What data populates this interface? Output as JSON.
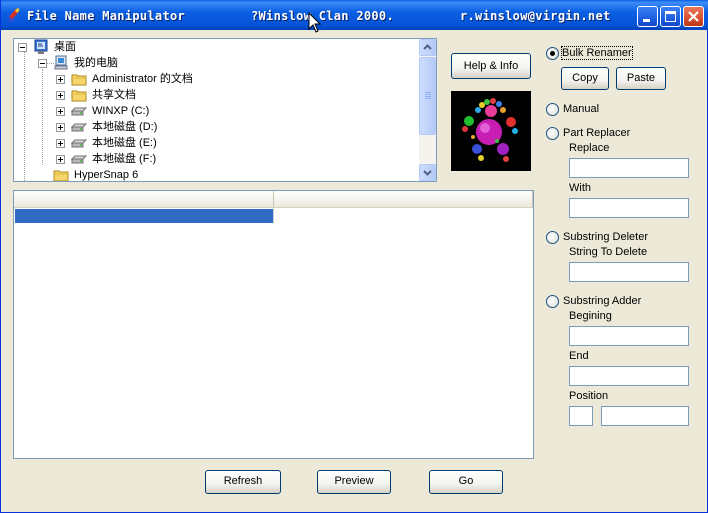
{
  "window": {
    "title_app": "File Name Manipulator",
    "title_author": "?Winslow Clan 2000.",
    "title_email": "r.winslow@virgin.net"
  },
  "tree": {
    "items": [
      {
        "label": "桌面",
        "icon": "desktop-icon"
      },
      {
        "label": "我的电脑",
        "icon": "computer-icon"
      },
      {
        "label": "Administrator 的文档",
        "icon": "folder-icon"
      },
      {
        "label": "共享文档",
        "icon": "folder-icon"
      },
      {
        "label": "WINXP (C:)",
        "icon": "drive-icon"
      },
      {
        "label": "本地磁盘 (D:)",
        "icon": "drive-icon"
      },
      {
        "label": "本地磁盘 (E:)",
        "icon": "drive-icon"
      },
      {
        "label": "本地磁盘 (F:)",
        "icon": "drive-icon"
      },
      {
        "label": "HyperSnap 6",
        "icon": "folder-icon"
      }
    ]
  },
  "buttons": {
    "help": "Help & Info",
    "copy": "Copy",
    "paste": "Paste",
    "refresh": "Refresh",
    "preview": "Preview",
    "go": "Go"
  },
  "options": {
    "bulk_renamer": "Bulk Renamer",
    "manual": "Manual",
    "part_replacer": "Part Replacer",
    "replace": "Replace",
    "with": "With",
    "substring_deleter": "Substring Deleter",
    "string_to_delete": "String To Delete",
    "substring_adder": "Substring Adder",
    "begining": "Begining",
    "end": "End",
    "position": "Position",
    "selected": "bulk_renamer"
  },
  "colors": {
    "titlebar": "#0553d6",
    "selection": "#316ac5",
    "face": "#ece9d8"
  }
}
